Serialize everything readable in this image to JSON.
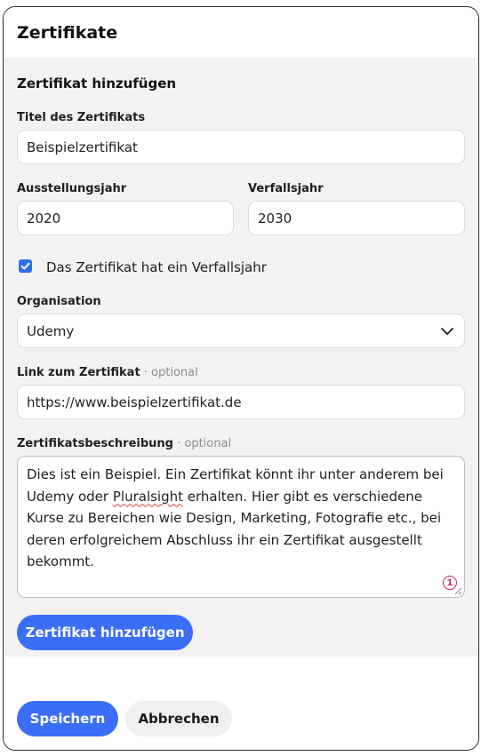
{
  "header": {
    "title": "Zertifikate"
  },
  "form": {
    "section_title": "Zertifikat hinzufügen",
    "title_label": "Titel des Zertifikats",
    "title_value": "Beispielzertifikat",
    "issue_year_label": "Ausstellungsjahr",
    "issue_year_value": "2020",
    "expiry_year_label": "Verfallsjahr",
    "expiry_year_value": "2030",
    "expiry_checkbox_label": "Das Zertifikat hat ein Verfallsjahr",
    "expiry_checkbox_checked": true,
    "organisation_label": "Organisation",
    "organisation_value": "Udemy",
    "link_label": "Link zum Zertifikat",
    "link_optional": " · optional",
    "link_value": "https://www.beispielzertifikat.de",
    "description_label": "Zertifikatsbeschreibung",
    "description_optional": " · optional",
    "description_part1": "Dies ist ein Beispiel. Ein Zertifikat könnt ihr unter anderem bei Udemy oder ",
    "description_misspelled": "Pluralsight",
    "description_part2": " erhalten. Hier gibt es verschiedene Kurse zu Bereichen wie Design, Marketing, Fotografie etc., bei deren erfolgreichem Abschluss ihr ein Zertifikat ausgestellt bekommt.",
    "spellcheck_count": "1",
    "add_button_label": "Zertifikat hinzufügen"
  },
  "footer": {
    "save_label": "Speichern",
    "cancel_label": "Abbrechen"
  },
  "colors": {
    "accent": "#3b6ef6",
    "panel_bg": "#f2f2f2",
    "spellcheck": "#d61f4f"
  }
}
